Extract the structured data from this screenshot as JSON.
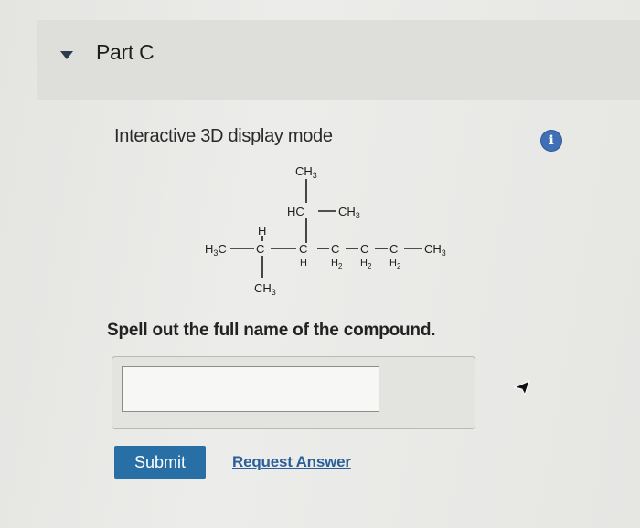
{
  "part": {
    "title": "Part C"
  },
  "display": {
    "mode_label": "Interactive 3D display mode",
    "info_icon": "info-icon"
  },
  "molecule": {
    "top_ch3": "CH",
    "top_ch3_sub": "3",
    "hc_label": "HC",
    "side_ch3": "CH",
    "side_ch3_sub": "3",
    "left_h3c": "H",
    "left_h3c_sub": "3",
    "left_h3c_c": "C",
    "h_label": "H",
    "c_label": "C",
    "h2_label": "H",
    "h2_sub": "2",
    "end_ch3": "CH",
    "end_ch3_sub": "3",
    "bottom_ch3": "CH",
    "bottom_ch3_sub": "3"
  },
  "question": {
    "prompt": "Spell out the full name of the compound."
  },
  "answer": {
    "value": "",
    "placeholder": ""
  },
  "actions": {
    "submit_label": "Submit",
    "request_label": "Request Answer"
  },
  "colors": {
    "accent": "#286fa6",
    "link": "#2b5f99",
    "info": "#3f6fb5"
  }
}
